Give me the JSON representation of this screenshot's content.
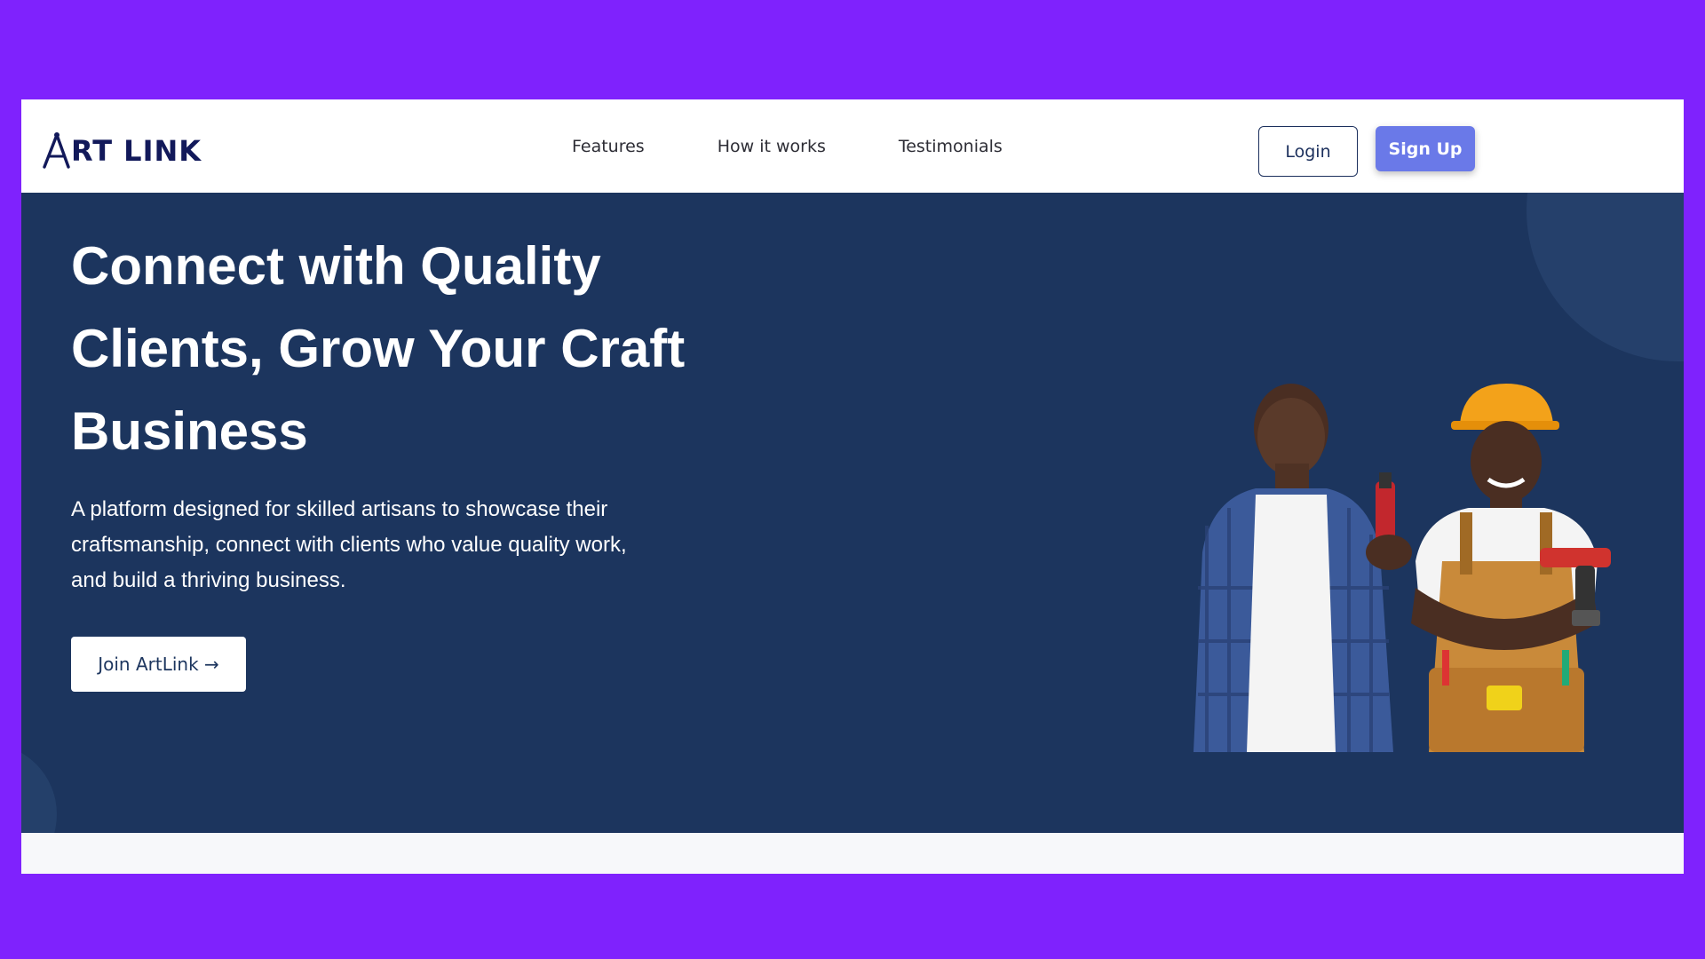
{
  "brand": {
    "name": "RT LINK",
    "logo_icon": "compass-a-logo-icon",
    "color": "#12195a"
  },
  "nav": {
    "links": [
      {
        "label": "Features"
      },
      {
        "label": "How it works"
      },
      {
        "label": "Testimonials"
      }
    ],
    "login_label": "Login",
    "signup_label": "Sign Up"
  },
  "hero": {
    "title": "Connect with Quality Clients, Grow Your Craft Business",
    "subtitle": "A platform designed for skilled artisans to showcase their craftsmanship, connect with clients who value quality work, and build a thriving business.",
    "cta_label": "Join ArtLink →",
    "image_icon": "artisans-illustration"
  },
  "colors": {
    "page_bg": "#7f22fd",
    "hero_bg": "#1c355e",
    "accent": "#6a79e8",
    "navy": "#1b2f5c"
  }
}
